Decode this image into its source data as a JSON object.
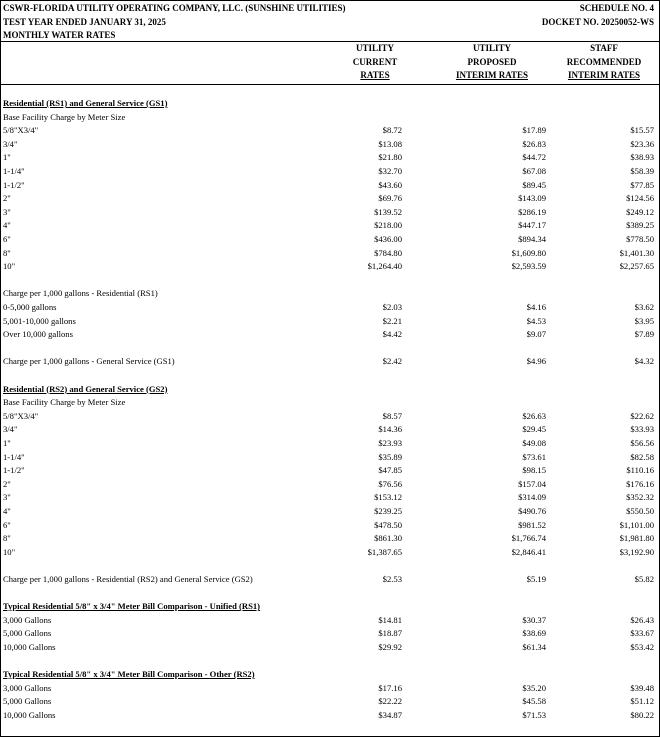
{
  "header": {
    "company": "CSWR-FLORIDA UTILITY OPERATING COMPANY, LLC. (SUNSHINE UTILITIES)",
    "test_year": "TEST YEAR ENDED JANUARY 31, 2025",
    "subtitle": "MONTHLY WATER RATES",
    "schedule": "SCHEDULE NO. 4",
    "docket": "DOCKET NO. 20250052-WS"
  },
  "columns": [
    {
      "lines": [
        "UTILITY",
        "CURRENT",
        "RATES"
      ]
    },
    {
      "lines": [
        "UTILITY",
        "PROPOSED",
        "INTERIM RATES"
      ]
    },
    {
      "lines": [
        "STAFF",
        "RECOMMENDED",
        "INTERIM RATES"
      ]
    }
  ],
  "rows": [
    {
      "label": "Residential (RS1) and General Service (GS1)",
      "style": "sec",
      "vals": [
        "",
        "",
        ""
      ]
    },
    {
      "label": "Base Facility Charge by Meter Size",
      "vals": [
        "",
        "",
        ""
      ]
    },
    {
      "label": "5/8\"X3/4\"",
      "vals": [
        "$8.72",
        "$17.89",
        "$15.57"
      ]
    },
    {
      "label": "3/4\"",
      "vals": [
        "$13.08",
        "$26.83",
        "$23.36"
      ]
    },
    {
      "label": "1\"",
      "vals": [
        "$21.80",
        "$44.72",
        "$38.93"
      ]
    },
    {
      "label": "1-1/4\"",
      "vals": [
        "$32.70",
        "$67.08",
        "$58.39"
      ]
    },
    {
      "label": "1-1/2\"",
      "vals": [
        "$43.60",
        "$89.45",
        "$77.85"
      ]
    },
    {
      "label": "2\"",
      "vals": [
        "$69.76",
        "$143.09",
        "$124.56"
      ]
    },
    {
      "label": "3\"",
      "vals": [
        "$139.52",
        "$286.19",
        "$249.12"
      ]
    },
    {
      "label": "4\"",
      "vals": [
        "$218.00",
        "$447.17",
        "$389.25"
      ]
    },
    {
      "label": "6\"",
      "vals": [
        "$436.00",
        "$894.34",
        "$778.50"
      ]
    },
    {
      "label": "8\"",
      "vals": [
        "$784.80",
        "$1,609.80",
        "$1,401.30"
      ]
    },
    {
      "label": "10\"",
      "vals": [
        "$1,264.40",
        "$2,593.59",
        "$2,257.65"
      ]
    },
    {
      "label": "",
      "vals": [
        "",
        "",
        ""
      ]
    },
    {
      "label": "Charge per 1,000 gallons - Residential (RS1)",
      "vals": [
        "",
        "",
        ""
      ]
    },
    {
      "label": "0-5,000 gallons",
      "vals": [
        "$2.03",
        "$4.16",
        "$3.62"
      ]
    },
    {
      "label": "5,001-10,000 gallons",
      "vals": [
        "$2.21",
        "$4.53",
        "$3.95"
      ]
    },
    {
      "label": "Over 10,000 gallons",
      "vals": [
        "$4.42",
        "$9.07",
        "$7.89"
      ]
    },
    {
      "label": "",
      "vals": [
        "",
        "",
        ""
      ]
    },
    {
      "label": "Charge per 1,000 gallons - General Service (GS1)",
      "vals": [
        "$2.42",
        "$4.96",
        "$4.32"
      ]
    },
    {
      "label": "",
      "vals": [
        "",
        "",
        ""
      ]
    },
    {
      "label": "Residential (RS2) and General Service (GS2)",
      "style": "sec",
      "vals": [
        "",
        "",
        ""
      ]
    },
    {
      "label": "Base Facility Charge by Meter Size",
      "vals": [
        "",
        "",
        ""
      ]
    },
    {
      "label": "5/8\"X3/4\"",
      "vals": [
        "$8.57",
        "$26.63",
        "$22.62"
      ]
    },
    {
      "label": "3/4\"",
      "vals": [
        "$14.36",
        "$29.45",
        "$33.93"
      ]
    },
    {
      "label": "1\"",
      "vals": [
        "$23.93",
        "$49.08",
        "$56.56"
      ]
    },
    {
      "label": "1-1/4\"",
      "vals": [
        "$35.89",
        "$73.61",
        "$82.58"
      ]
    },
    {
      "label": "1-1/2\"",
      "vals": [
        "$47.85",
        "$98.15",
        "$110.16"
      ]
    },
    {
      "label": "2\"",
      "vals": [
        "$76.56",
        "$157.04",
        "$176.16"
      ]
    },
    {
      "label": "3\"",
      "vals": [
        "$153.12",
        "$314.09",
        "$352.32"
      ]
    },
    {
      "label": "4\"",
      "vals": [
        "$239.25",
        "$490.76",
        "$550.50"
      ]
    },
    {
      "label": "6\"",
      "vals": [
        "$478.50",
        "$981.52",
        "$1,101.00"
      ]
    },
    {
      "label": "8\"",
      "vals": [
        "$861.30",
        "$1,766.74",
        "$1,981.80"
      ]
    },
    {
      "label": "10\"",
      "vals": [
        "$1,387.65",
        "$2,846.41",
        "$3,192.90"
      ]
    },
    {
      "label": "",
      "vals": [
        "",
        "",
        ""
      ]
    },
    {
      "label": "Charge per 1,000 gallons - Residential (RS2) and General Service (GS2)",
      "vals": [
        "$2.53",
        "$5.19",
        "$5.82"
      ]
    },
    {
      "label": "",
      "vals": [
        "",
        "",
        ""
      ]
    },
    {
      "label": "Typical Residential 5/8\" x 3/4\" Meter Bill Comparison - Unified (RS1)",
      "style": "sec",
      "vals": [
        "",
        "",
        ""
      ]
    },
    {
      "label": "3,000 Gallons",
      "vals": [
        "$14.81",
        "$30.37",
        "$26.43"
      ]
    },
    {
      "label": "5,000 Gallons",
      "vals": [
        "$18.87",
        "$38.69",
        "$33.67"
      ]
    },
    {
      "label": "10,000 Gallons",
      "vals": [
        "$29.92",
        "$61.34",
        "$53.42"
      ]
    },
    {
      "label": "",
      "vals": [
        "",
        "",
        ""
      ]
    },
    {
      "label": "Typical Residential 5/8\" x 3/4\" Meter Bill Comparison - Other (RS2)",
      "style": "sec",
      "vals": [
        "",
        "",
        ""
      ]
    },
    {
      "label": "3,000 Gallons",
      "vals": [
        "$17.16",
        "$35.20",
        "$39.48"
      ]
    },
    {
      "label": "5,000 Gallons",
      "vals": [
        "$22.22",
        "$45.58",
        "$51.12"
      ]
    },
    {
      "label": "10,000 Gallons",
      "vals": [
        "$34.87",
        "$71.53",
        "$80.22"
      ]
    }
  ]
}
